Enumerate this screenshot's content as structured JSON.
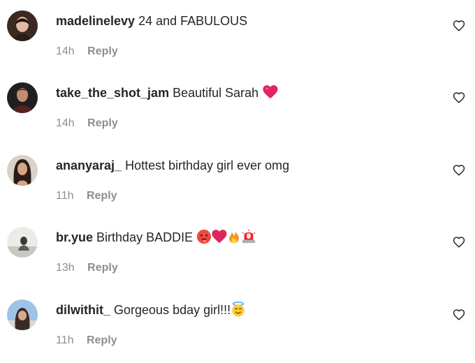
{
  "comments": [
    {
      "username": "madelinelevy",
      "text": "24 and FABULOUS",
      "time": "14h",
      "reply_label": "Reply",
      "avatar_icon": "avatar-dark-hair-woman",
      "emojis": []
    },
    {
      "username": "take_the_shot_jam",
      "text": "Beautiful Sarah",
      "time": "14h",
      "reply_label": "Reply",
      "avatar_icon": "avatar-man-dark-background",
      "emojis": [
        "red-heart-emoji"
      ]
    },
    {
      "username": "ananyaraj_",
      "text": "Hottest birthday girl ever omg",
      "time": "11h",
      "reply_label": "Reply",
      "avatar_icon": "avatar-woman-long-hair",
      "emojis": []
    },
    {
      "username": "br.yue",
      "text": "Birthday BADDIE",
      "time": "13h",
      "reply_label": "Reply",
      "avatar_icon": "avatar-light-photo",
      "emojis": [
        "hot-face-emoji",
        "red-heart-emoji",
        "fire-emoji",
        "police-light-emoji"
      ]
    },
    {
      "username": "dilwithit_",
      "text": "Gorgeous bday girl!!!",
      "time": "11h",
      "reply_label": "Reply",
      "avatar_icon": "avatar-woman-blue-background",
      "emojis": [
        "smiling-face-with-halo-emoji"
      ]
    }
  ],
  "colors": {
    "text": "#262626",
    "secondary": "#8e8e8e",
    "heart_emoji": "#e0245e"
  },
  "like_icon": "heart-outline-icon"
}
